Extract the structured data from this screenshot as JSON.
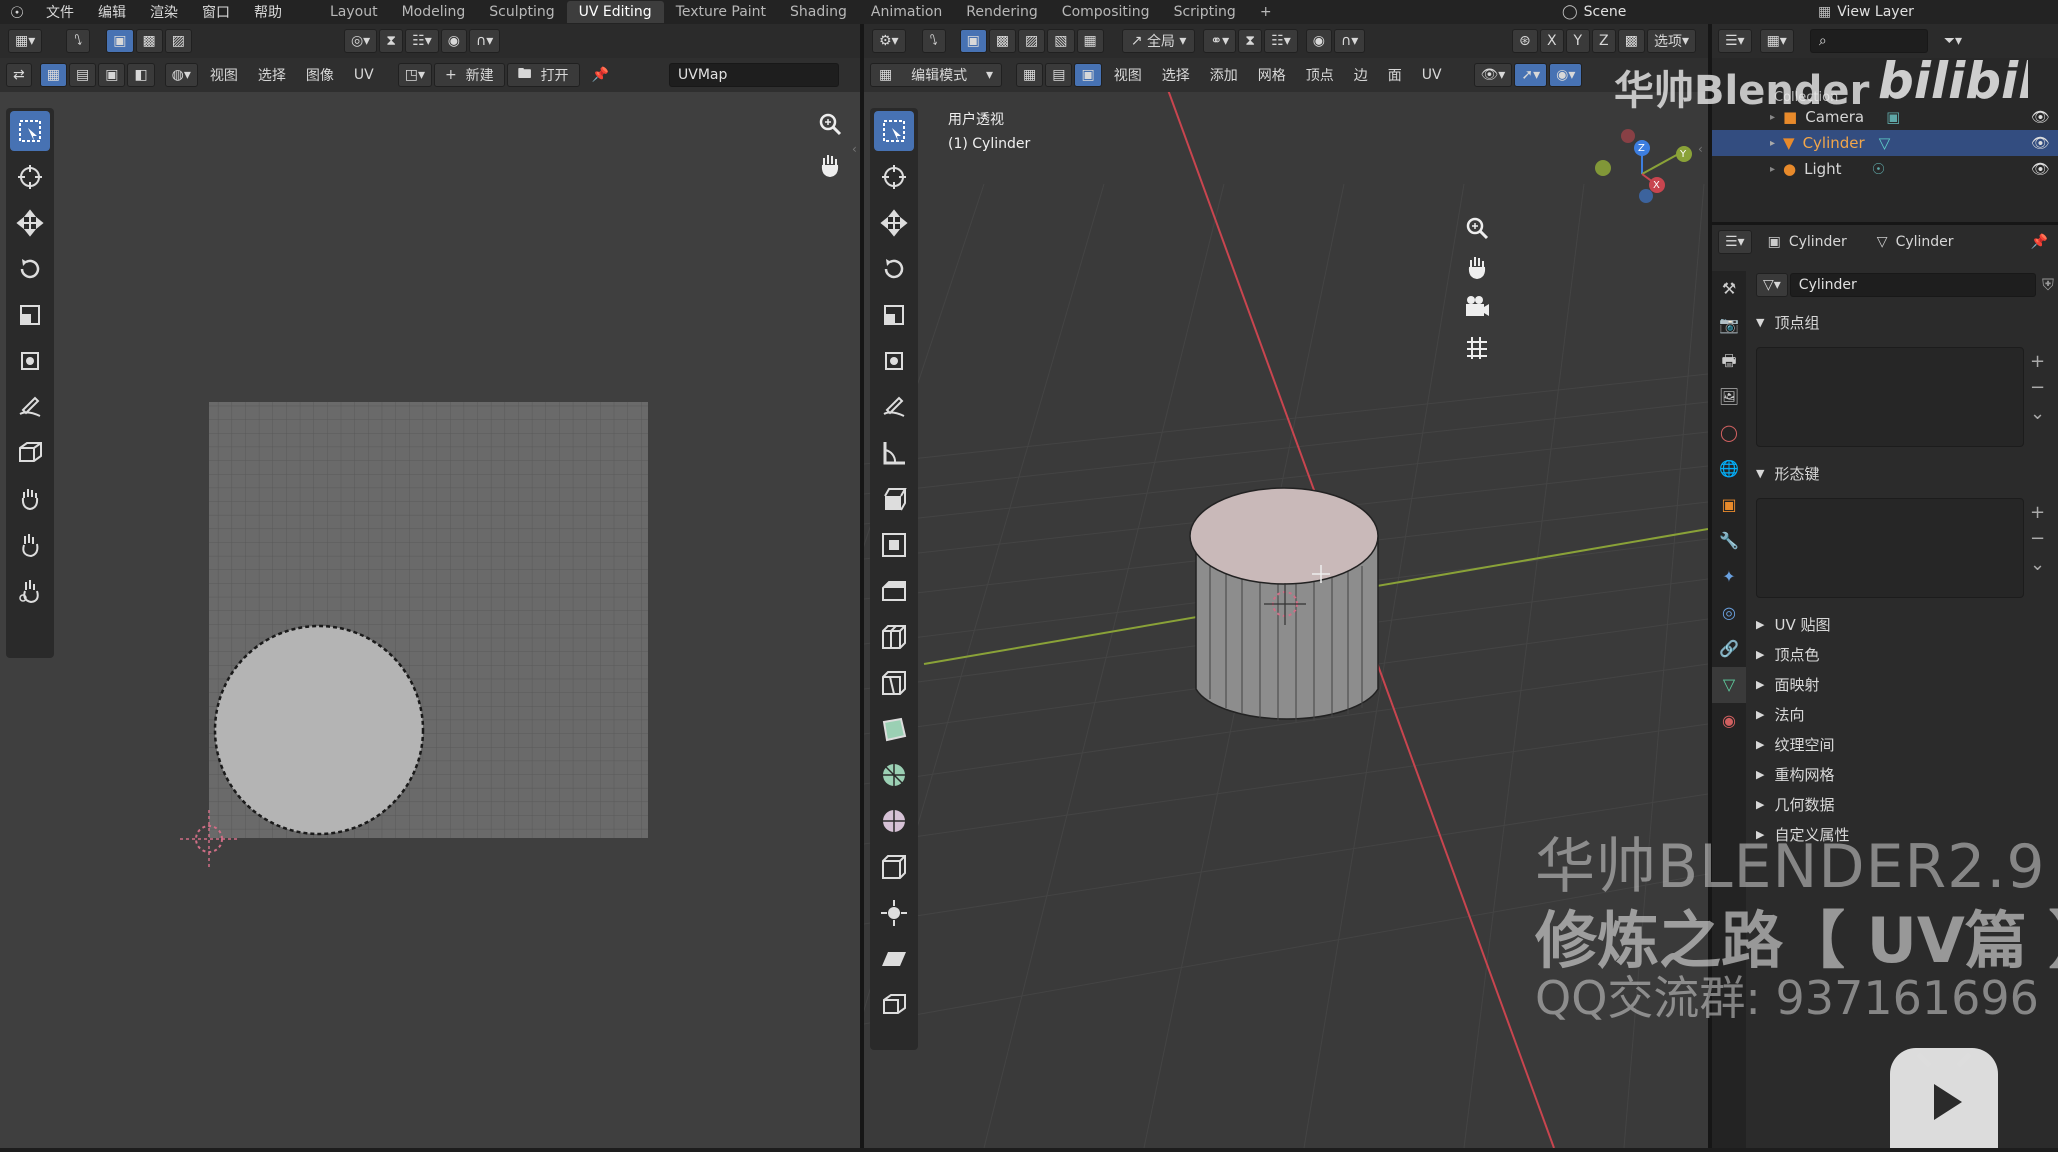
{
  "topbar": {
    "menus": [
      "文件",
      "编辑",
      "渲染",
      "窗口",
      "帮助"
    ],
    "workspaces": [
      "Layout",
      "Modeling",
      "Sculpting",
      "UV Editing",
      "Texture Paint",
      "Shading",
      "Animation",
      "Rendering",
      "Compositing",
      "Scripting"
    ],
    "active_workspace": "UV Editing",
    "add_tab": "+",
    "scene": "Scene",
    "view_layer": "View Layer"
  },
  "uv_editor": {
    "menus": [
      "视图",
      "选择",
      "图像",
      "UV"
    ],
    "new_label": "新建",
    "open_label": "打开",
    "uvmap": "UVMap"
  },
  "viewport": {
    "mode": "编辑模式",
    "transform_orientation": "全局",
    "options": "选项",
    "axes": [
      "X",
      "Y",
      "Z"
    ],
    "menus": [
      "视图",
      "选择",
      "添加",
      "网格",
      "顶点",
      "边",
      "面",
      "UV"
    ],
    "view_name": "用户透视",
    "object_name": "(1) Cylinder",
    "gizmo_labels": {
      "z": "Z",
      "y": "Y",
      "x": "X"
    }
  },
  "outliner": {
    "items": [
      {
        "label": "Collection",
        "selected": false
      },
      {
        "label": "Camera",
        "selected": false
      },
      {
        "label": "Cylinder",
        "selected": true
      },
      {
        "label": "Light",
        "selected": false
      }
    ]
  },
  "properties": {
    "object_name": "Cylinder",
    "data_name": "Cylinder",
    "mesh_name": "Cylinder",
    "vertex_groups": "顶点组",
    "shape_keys": "形态键",
    "sections": [
      "UV 贴图",
      "顶点色",
      "面映射",
      "法向",
      "纹理空间",
      "重构网格",
      "几何数据",
      "自定义属性"
    ]
  },
  "watermark": {
    "top": "华帅Blender",
    "line1": "华帅BLENDER2.9",
    "line2": "修炼之路【 UV篇 】",
    "line3": "QQ交流群: 937161696"
  },
  "colors": {
    "accent": "#4772b3",
    "x_axis": "#c8454f",
    "y_axis": "#8aa238",
    "z_axis": "#3d7ee0",
    "orange": "#e88a2b"
  }
}
